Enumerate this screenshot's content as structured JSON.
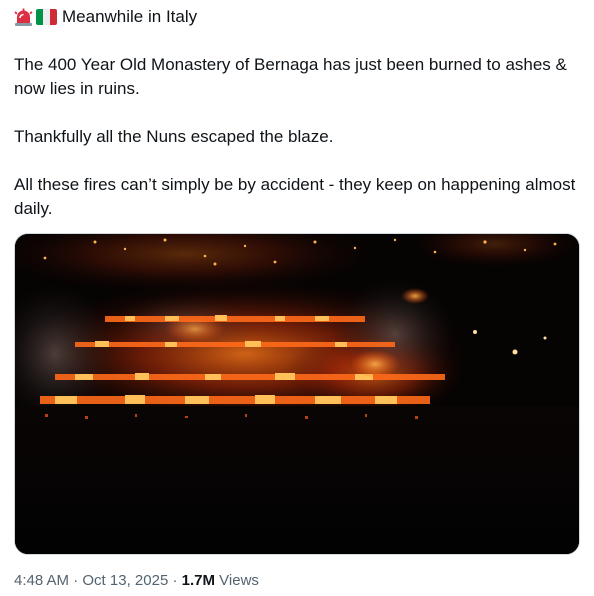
{
  "tweet": {
    "header_text": "Meanwhile in Italy",
    "header_icons": [
      "rotating-light-icon",
      "italy-flag-icon"
    ],
    "paragraphs": [
      "The 400 Year Old Monastery of Bernaga has just been burned to ashes & now lies in ruins.",
      "Thankfully all the Nuns escaped the blaze.",
      "All these fires can’t simply be by accident - they keep on happening almost daily."
    ],
    "time": "4:48 AM",
    "separator": " · ",
    "date": "Oct 13, 2025",
    "views_count": "1.7M",
    "views_label": "Views"
  },
  "colors": {
    "text": "#0f1419",
    "secondary_text": "#536471",
    "fire": "#ff5a1a",
    "border": "#cfd9de"
  }
}
